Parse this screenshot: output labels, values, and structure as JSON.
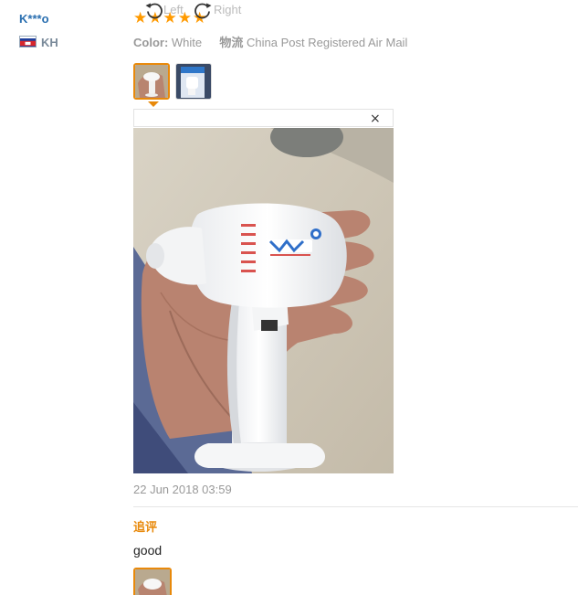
{
  "review": {
    "username": "K***o",
    "country_code": "KH",
    "rating": 5,
    "stars": [
      "★",
      "★",
      "★",
      "★",
      "★"
    ],
    "color_label": "Color:",
    "color_value": "White",
    "shipping_label": "物流",
    "shipping_value": "China Post Registered Air Mail",
    "date": "22 Jun 2018 03:59",
    "followup_label": "追评",
    "followup_text": "good"
  },
  "viewer": {
    "rotate_left_label": "Left",
    "rotate_right_label": "Right",
    "close_glyph": "×"
  },
  "icons": {
    "rotate_left": "rotate-left-icon",
    "rotate_right": "rotate-right-icon",
    "close": "close-icon",
    "flag": "flag-cambodia-icon"
  },
  "colors": {
    "star": "#ff9a00",
    "accent": "#e8890b",
    "username": "#2a6fb0",
    "muted": "#999999"
  }
}
